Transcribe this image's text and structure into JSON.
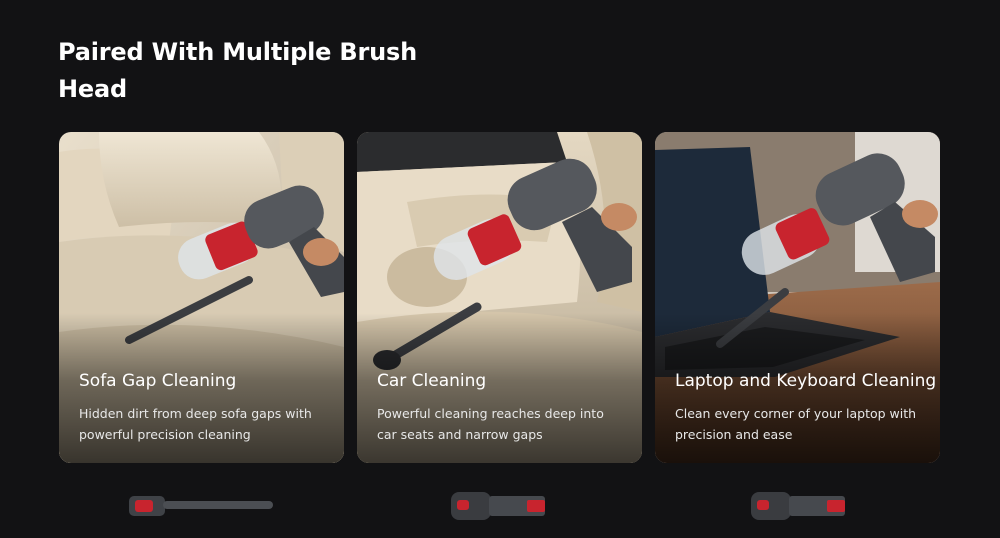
{
  "section": {
    "heading": "Paired With Multiple Brush Head"
  },
  "cards": [
    {
      "title": "Sofa Gap Cleaning",
      "description": "Hidden dirt from deep sofa gaps with powerful precision cleaning"
    },
    {
      "title": "Car Cleaning",
      "description": "Powerful cleaning reaches deep into car seats and narrow gaps"
    },
    {
      "title": "Laptop and Keyboard Cleaning",
      "description": "Clean every corner of your laptop with precision and ease"
    }
  ],
  "accessories": [
    {
      "icon": "crevice-tool-icon"
    },
    {
      "icon": "brush-tool-icon"
    },
    {
      "icon": "dusting-brush-icon"
    }
  ],
  "colors": {
    "background": "#121214",
    "accent_red": "#c8242e",
    "vacuum_grey": "#4a4d52"
  }
}
